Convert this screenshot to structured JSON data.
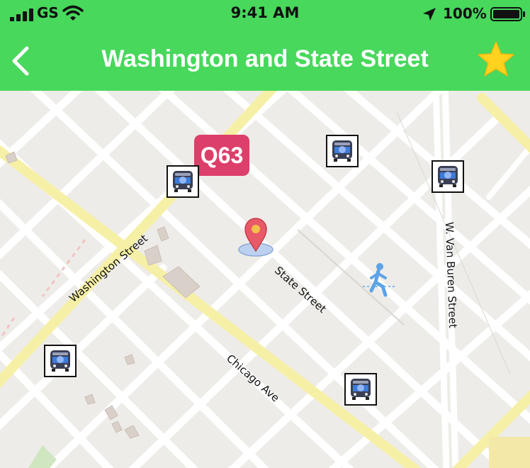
{
  "status_bar": {
    "carrier": "GS",
    "time": "9:41 AM",
    "battery": "100%",
    "icons": [
      "signal-bars-icon",
      "wifi-icon",
      "location-arrow-icon",
      "battery-icon"
    ]
  },
  "nav": {
    "title": "Washington and State Street",
    "back_icon": "chevron-left-icon",
    "favorite_icon": "star-icon"
  },
  "map": {
    "route_badge": "Q63",
    "streets": {
      "washington": "Washington Street",
      "state": "State Street",
      "chicago": "Chicago Ave",
      "van_buren": "W. Van Buren Street"
    },
    "markers": [
      "bus-stop-icon",
      "location-pin-icon",
      "pedestrian-icon"
    ]
  },
  "colors": {
    "header": "#47d85c",
    "badge": "#dc3f6a",
    "star": "#ffd21f",
    "map_bg": "#eeece8",
    "major_road": "#f6f0a6"
  }
}
